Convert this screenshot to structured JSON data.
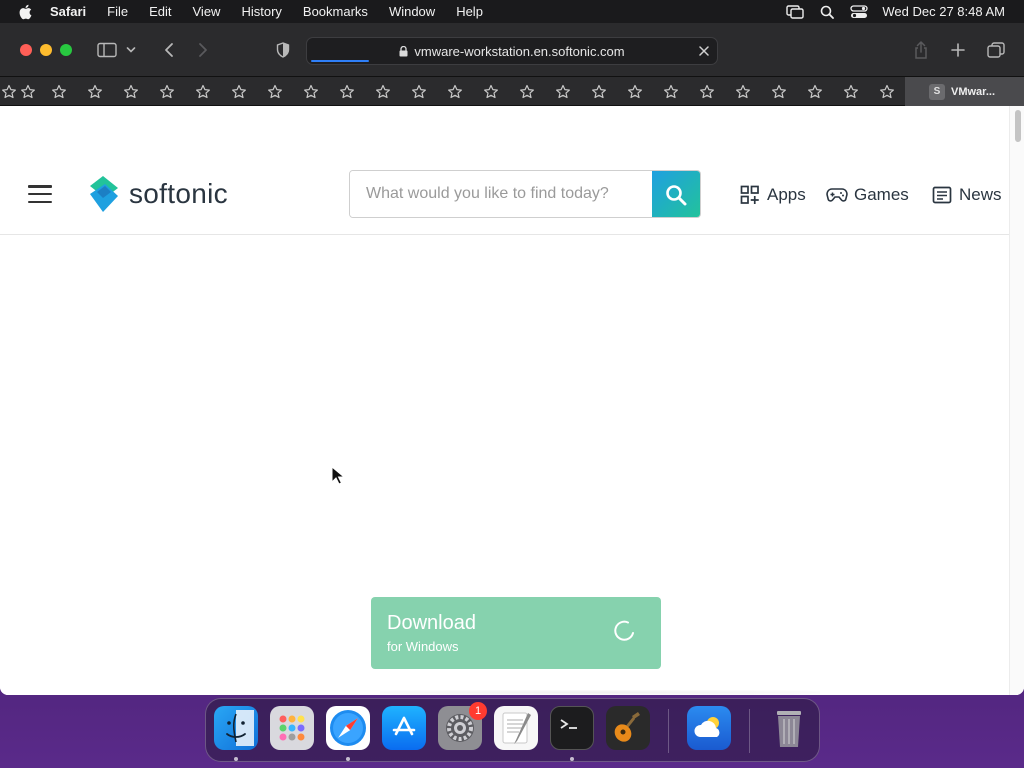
{
  "menubar": {
    "app_name": "Safari",
    "items": [
      "File",
      "Edit",
      "View",
      "History",
      "Bookmarks",
      "Window",
      "Help"
    ],
    "clock": "Wed Dec 27  8:48 AM"
  },
  "browser": {
    "url": "vmware-workstation.en.softonic.com",
    "tab_title": "VMwar...",
    "tab_favicon_letter": "S"
  },
  "site": {
    "logo_text": "softonic",
    "search_placeholder": "What would you like to find today?",
    "nav": {
      "apps": "Apps",
      "games": "Games",
      "news": "News"
    },
    "download": {
      "title": "Download",
      "subtitle": "for Windows"
    },
    "colors": {
      "download_bg": "#86d2ae",
      "search_btn_start": "#1fa0e0",
      "search_btn_end": "#22c39a"
    }
  },
  "dock": {
    "settings_badge": "1"
  }
}
